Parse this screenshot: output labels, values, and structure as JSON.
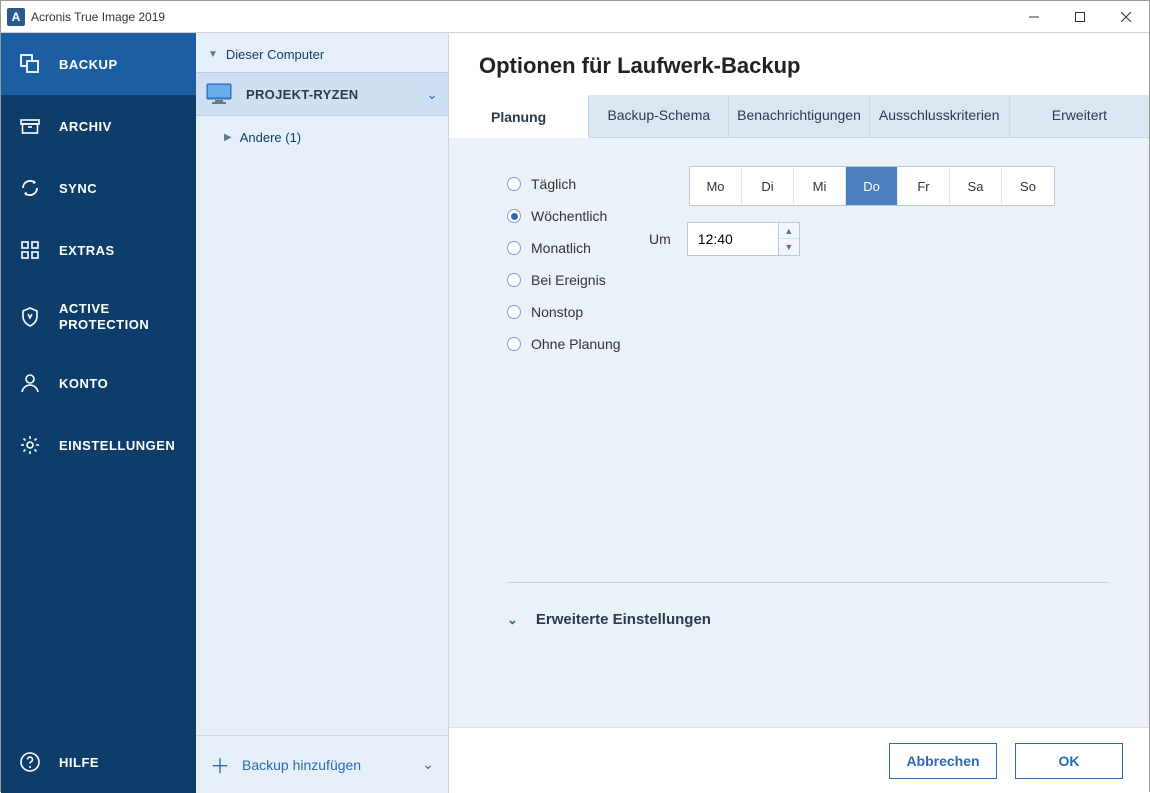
{
  "titlebar": {
    "app_title": "Acronis True Image 2019",
    "app_initial": "A"
  },
  "nav": {
    "items": [
      {
        "label": "BACKUP"
      },
      {
        "label": "ARCHIV"
      },
      {
        "label": "SYNC"
      },
      {
        "label": "EXTRAS"
      },
      {
        "label": "ACTIVE PROTECTION"
      },
      {
        "label": "KONTO"
      },
      {
        "label": "EINSTELLUNGEN"
      }
    ],
    "help_label": "HILFE"
  },
  "midcol": {
    "header": "Dieser Computer",
    "selected_source": "PROJEKT-RYZEN",
    "other_label": "Andere (1)",
    "add_backup_label": "Backup hinzufügen"
  },
  "main": {
    "title": "Optionen für Laufwerk-Backup",
    "tabs": [
      "Planung",
      "Backup-Schema",
      "Benachrichtigungen",
      "Ausschlusskriterien",
      "Erweitert"
    ],
    "active_tab": 0,
    "schedule_options": [
      "Täglich",
      "Wöchentlich",
      "Monatlich",
      "Bei Ereignis",
      "Nonstop",
      "Ohne Planung"
    ],
    "schedule_selected": 1,
    "days": [
      "Mo",
      "Di",
      "Mi",
      "Do",
      "Fr",
      "Sa",
      "So"
    ],
    "day_selected": 3,
    "time_label": "Um",
    "time_value": "12:40",
    "advanced_label": "Erweiterte Einstellungen"
  },
  "footer": {
    "cancel": "Abbrechen",
    "ok": "OK"
  }
}
